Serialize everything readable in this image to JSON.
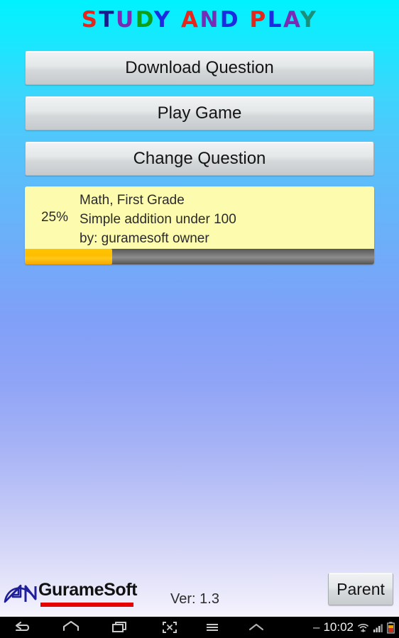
{
  "app": {
    "title_letters": [
      {
        "char": "S",
        "color": "#e8251a"
      },
      {
        "char": "T",
        "color": "#1a1a8c"
      },
      {
        "char": "U",
        "color": "#7a2bb5"
      },
      {
        "char": "D",
        "color": "#0f9e18"
      },
      {
        "char": "Y",
        "color": "#1b2ce0"
      },
      {
        "char": " ",
        "color": "#00f2ff"
      },
      {
        "char": "A",
        "color": "#e8251a"
      },
      {
        "char": "N",
        "color": "#7a2bb5"
      },
      {
        "char": "D",
        "color": "#1b2ce0"
      },
      {
        "char": " ",
        "color": "#00f2ff"
      },
      {
        "char": "P",
        "color": "#e8251a"
      },
      {
        "char": "L",
        "color": "#1b2ce0"
      },
      {
        "char": "A",
        "color": "#7a2bb5"
      },
      {
        "char": "Y",
        "color": "#1a8f7a"
      }
    ],
    "title_text": "STUDY AND PLAY",
    "background_top_color": "#00f2ff",
    "background_bottom_color": "#fbfaff"
  },
  "buttons": {
    "download_label": "Download Question",
    "play_label": "Play Game",
    "change_label": "Change Question",
    "parent_label": "Parent"
  },
  "info_panel": {
    "percent": "25%",
    "progress_value": 25,
    "subject_line": "Math, First Grade",
    "description_line": "Simple addition under 100",
    "author_line": "by: guramesoft owner",
    "panel_color": "#fdfcae",
    "progress_fill_color": "#ffc400",
    "progress_track_color": "#828282"
  },
  "footer": {
    "logo_text": "GurameSoft",
    "logo_mark_color": "#1f1f9b",
    "logo_underline_color": "#e70000",
    "version_label": "Ver: 1.3"
  },
  "navbar": {
    "back_icon": "back-arrow-icon",
    "home_icon": "home-icon",
    "recents_icon": "recent-apps-icon",
    "screenshot_icon": "screenshot-icon",
    "menu_icon": "menu-icon",
    "expand_icon": "chevron-up-icon",
    "dash": "–",
    "clock": "10:02",
    "wifi_icon": "wifi-icon",
    "signal_icon": "signal-bars-icon",
    "battery_icon": "battery-low-icon"
  }
}
